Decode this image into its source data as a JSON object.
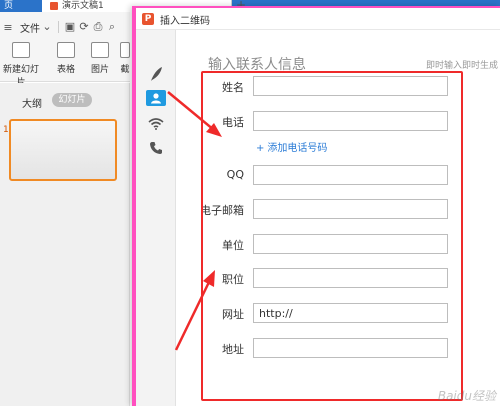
{
  "app": {
    "home_tab": "页",
    "doc_tab_title": "演示文稿1",
    "new_tab_symbol": "+",
    "file_menu": "文件",
    "ribbon": [
      "新建幻灯片",
      "表格",
      "图片",
      "截"
    ],
    "outline_tabs": {
      "outline": "大纲",
      "slides": "幻灯片"
    },
    "slide_number": "1"
  },
  "dialog": {
    "title": "插入二维码",
    "sidebar_icons": [
      "feather-icon",
      "contact-icon",
      "wifi-icon",
      "phone-icon"
    ],
    "form_header": "输入联系人信息",
    "form_hint": "即时输入即时生成",
    "add_phone_label": "添加电话号码",
    "fields": [
      {
        "label": "姓名",
        "value": ""
      },
      {
        "label": "电话",
        "value": ""
      },
      {
        "label": "QQ",
        "value": ""
      },
      {
        "label": "电子邮箱",
        "value": ""
      },
      {
        "label": "单位",
        "value": ""
      },
      {
        "label": "职位",
        "value": ""
      },
      {
        "label": "网址",
        "value": "http://"
      },
      {
        "label": "地址",
        "value": ""
      }
    ]
  },
  "colors": {
    "annotation_red": "#ef2a2a",
    "accent_blue": "#1f9ae0",
    "link_blue": "#2a7bd6",
    "window_border_pink": "#ff4fbf"
  },
  "watermark": "Baidu经验"
}
